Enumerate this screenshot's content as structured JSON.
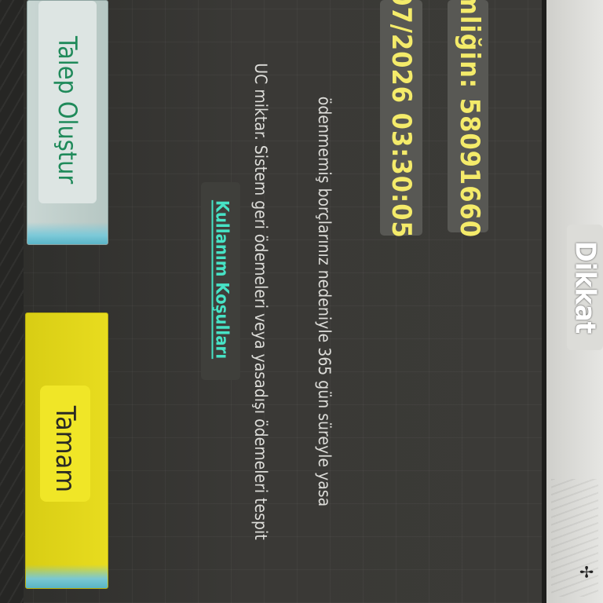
{
  "dialog": {
    "title": "Dikkat",
    "account_id_line": "mliğin: 58091660",
    "date_line": "07/2026 03:30:05",
    "message_line1": "ödenmemiş borçlarınız nedeniyle 365 gün süreyle yasa",
    "message_line2": "UC miktar. Sistem geri ödemeleri veya yasadışı ödemeleri tespit",
    "terms_link": "Kullanım Koşulları"
  },
  "buttons": {
    "create_request": "Talep Oluştur",
    "ok": "Tamam"
  },
  "colors": {
    "highlight_text": "#f4eb6a",
    "link": "#47e3c6",
    "ok_button": "#e8dc1f",
    "create_button_text": "#1f8a5a"
  }
}
